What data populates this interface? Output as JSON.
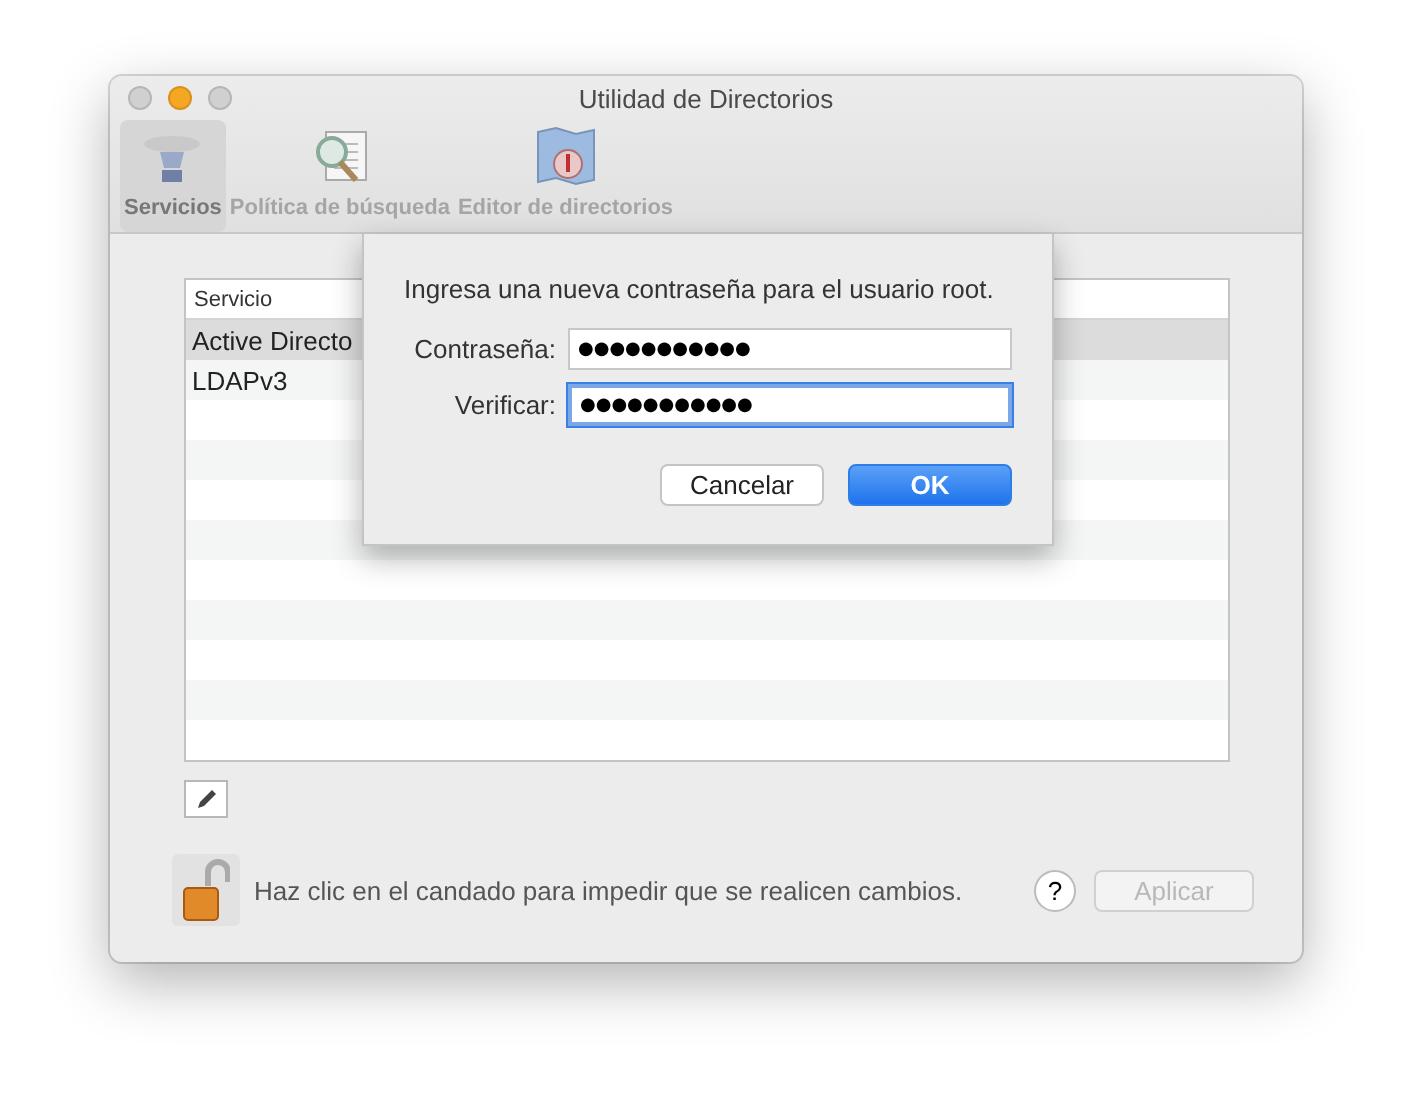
{
  "window": {
    "title": "Utilidad de Directorios"
  },
  "toolbar": [
    {
      "label": "Servicios",
      "selected": true,
      "kind": "services"
    },
    {
      "label": "Política de búsqueda",
      "selected": false,
      "kind": "search"
    },
    {
      "label": "Editor de directorios",
      "selected": false,
      "kind": "editor"
    }
  ],
  "table": {
    "columns": [
      "Servicio"
    ],
    "rows": [
      {
        "cells": [
          "Active Directo"
        ],
        "selected": true
      },
      {
        "cells": [
          "LDAPv3"
        ],
        "selected": false
      }
    ]
  },
  "sheet": {
    "message": "Ingresa una nueva contraseña para el usuario root.",
    "fields": [
      {
        "label": "Contraseña:",
        "value": "●●●●●●●●●●●",
        "focused": false
      },
      {
        "label": "Verificar:",
        "value": "●●●●●●●●●●●",
        "focused": true
      }
    ],
    "buttons": [
      {
        "label": "Cancelar",
        "default": false
      },
      {
        "label": "OK",
        "default": true
      }
    ]
  },
  "lock": {
    "message": "Haz clic en el candado para impedir que se realicen cambios.",
    "locked": false
  },
  "help": "?",
  "apply": {
    "label": "Aplicar",
    "disabled": true
  }
}
